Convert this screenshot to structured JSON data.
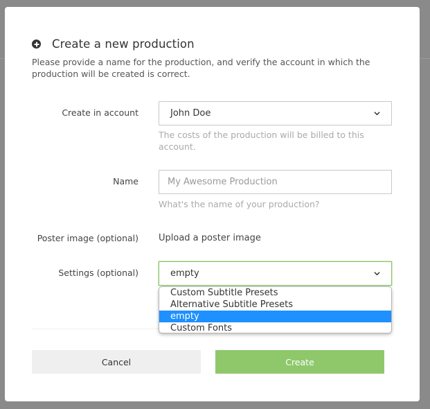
{
  "dialog": {
    "title": "Create a new production",
    "intro": "Please provide a name for the production, and verify the account in which the production will be created is correct."
  },
  "fields": {
    "account": {
      "label": "Create in account",
      "value": "John Doe",
      "help": "The costs of the production will be billed to this account."
    },
    "name": {
      "label": "Name",
      "placeholder": "My Awesome Production",
      "help": "What's the name of your production?"
    },
    "poster": {
      "label": "Poster image (optional)",
      "action": "Upload a poster image"
    },
    "settings": {
      "label": "Settings (optional)",
      "value": "empty",
      "options": [
        "Custom Subtitle Presets",
        "Alternative Subtitle Presets",
        "empty",
        "Custom Fonts"
      ],
      "highlighted_index": 2
    }
  },
  "buttons": {
    "cancel": "Cancel",
    "create": "Create"
  },
  "colors": {
    "create_button": "#8ec86b",
    "dropdown_highlight": "#1e90ff",
    "focus_border": "#8dc46b"
  }
}
